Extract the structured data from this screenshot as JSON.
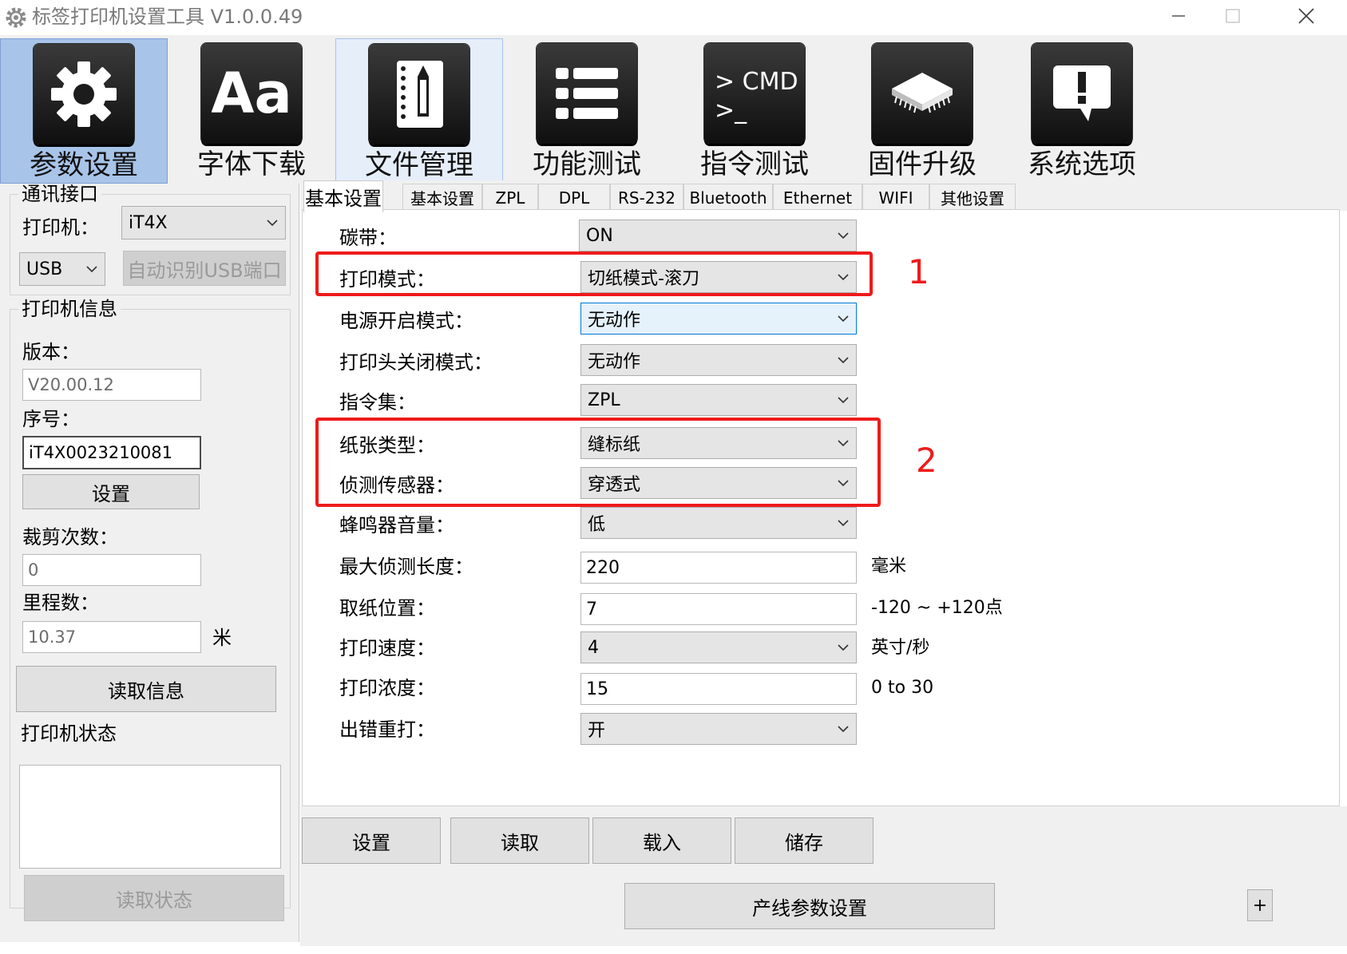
{
  "window": {
    "title": "标签打印机设置工具  V1.0.0.49",
    "controls": [
      "minimize",
      "maximize",
      "close"
    ]
  },
  "toolbar": [
    {
      "label": "参数设置",
      "icon": "gear-icon",
      "state": "active"
    },
    {
      "label": "字体下载",
      "icon": "font-icon",
      "state": "normal"
    },
    {
      "label": "文件管理",
      "icon": "notebook-icon",
      "state": "hover"
    },
    {
      "label": "功能测试",
      "icon": "list-icon",
      "state": "normal"
    },
    {
      "label": "指令测试",
      "icon": "cmd-icon",
      "cmd_text": "> CMD",
      "state": "normal"
    },
    {
      "label": "固件升级",
      "icon": "chip-icon",
      "state": "normal"
    },
    {
      "label": "系统选项",
      "icon": "alert-icon",
      "state": "normal"
    }
  ],
  "comm": {
    "legend": "通讯接口",
    "printer_label": "打印机：",
    "printer_value": "iT4X",
    "port_value": "USB",
    "auto_detect_button": "自动识别USB端口"
  },
  "info": {
    "legend": "打印机信息",
    "version_label": "版本：",
    "version_value": "V20.00.12",
    "serial_label": "序号：",
    "serial_value": "iT4X0023210081",
    "set_button": "设置",
    "cut_label": "裁剪次数：",
    "cut_value": "0",
    "mileage_label": "里程数：",
    "mileage_value": "10.37",
    "mileage_unit": "米",
    "read_info_button": "读取信息"
  },
  "status": {
    "legend": "打印机状态",
    "read_status_button": "读取状态"
  },
  "tabs": [
    "基本设置",
    "基本设置",
    "ZPL",
    "DPL",
    "RS-232",
    "Bluetooth",
    "Ethernet",
    "WIFI",
    "其他设置"
  ],
  "settings": [
    {
      "label": "碳带：",
      "type": "combo",
      "value": "ON"
    },
    {
      "label": "打印模式：",
      "type": "combo",
      "value": "切纸模式-滚刀"
    },
    {
      "label": "电源开启模式：",
      "type": "combo",
      "value": "无动作"
    },
    {
      "label": "打印头关闭模式：",
      "type": "combo",
      "value": "无动作"
    },
    {
      "label": "指令集：",
      "type": "combo",
      "value": "ZPL"
    },
    {
      "label": "纸张类型：",
      "type": "combo",
      "value": "缝标纸"
    },
    {
      "label": "侦测传感器：",
      "type": "combo",
      "value": "穿透式"
    },
    {
      "label": "蜂鸣器音量：",
      "type": "combo",
      "value": "低"
    },
    {
      "label": "最大侦测长度：",
      "type": "text",
      "value": "220",
      "unit": "毫米"
    },
    {
      "label": "取纸位置：",
      "type": "text",
      "value": "7",
      "unit": "-120 ~ +120点"
    },
    {
      "label": "打印速度：",
      "type": "combo",
      "value": "4",
      "unit": "英寸/秒"
    },
    {
      "label": "打印浓度：",
      "type": "text",
      "value": "15",
      "unit": "0 to 30"
    },
    {
      "label": "出错重打：",
      "type": "combo",
      "value": "开"
    }
  ],
  "annotations": [
    "1",
    "2"
  ],
  "actions": {
    "set": "设置",
    "read": "读取",
    "load": "载入",
    "save": "储存",
    "production_line": "产线参数设置",
    "expand": "+"
  },
  "colors": {
    "annotation_red": "#ee1b1b",
    "toolbar_active": "#a8c4e8",
    "window_bg": "#f0f0f0"
  }
}
